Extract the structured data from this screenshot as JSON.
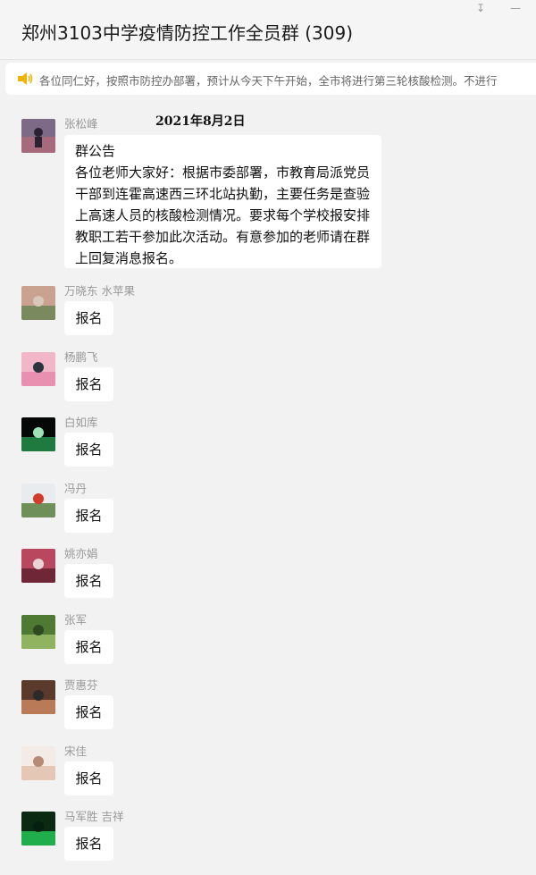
{
  "window": {
    "title": "郑州3103中学疫情防控工作全员群 (309)",
    "pin_glyph": "↧",
    "minimize_glyph": "—"
  },
  "notice": {
    "text": "各位同仁好，按照市防控办部署，预计从今天下午开始，全市将进行第三轮核酸检测。不进行"
  },
  "chat": {
    "date_stamp": "2021年8月2日",
    "announcement": {
      "sender": "张松峰",
      "title": "群公告",
      "body": "各位老师大家好：根据市委部署，市教育局派党员干部到连霍高速西三环北站执勤，主要任务是查验上高速人员的核酸检测情况。要求每个学校报安排教职工若干参加此次活动。有意参加的老师请在群上回复消息报名。"
    },
    "replies": [
      {
        "sender": "万晓东 水苹果",
        "text": "报名",
        "avatar_colors": [
          "#c9a38f",
          "#7a8a5e",
          "#d8c7bb"
        ]
      },
      {
        "sender": "杨鹏飞",
        "text": "报名",
        "avatar_colors": [
          "#f1b7c9",
          "#e98fb0",
          "#2c3442"
        ]
      },
      {
        "sender": "白如库",
        "text": "报名",
        "avatar_colors": [
          "#050806",
          "#1f7a3f",
          "#9ee2b8"
        ]
      },
      {
        "sender": "冯丹",
        "text": "报名",
        "avatar_colors": [
          "#e9ecef",
          "#6f8f5a",
          "#d33b2a"
        ]
      },
      {
        "sender": "姚亦娟",
        "text": "报名",
        "avatar_colors": [
          "#b9485e",
          "#6f2636",
          "#e8d4d6"
        ]
      },
      {
        "sender": "张军",
        "text": "报名",
        "avatar_colors": [
          "#4f7a34",
          "#8fb35f",
          "#2f4a23"
        ]
      },
      {
        "sender": "贾惠芬",
        "text": "报名",
        "avatar_colors": [
          "#5a3a2a",
          "#b97a57",
          "#2f2a2a"
        ]
      },
      {
        "sender": "宋佳",
        "text": "报名",
        "avatar_colors": [
          "#f3ece6",
          "#e4c7b4",
          "#b78a74"
        ]
      },
      {
        "sender": "马军胜 吉祥",
        "text": "报名",
        "avatar_colors": [
          "#0b2a12",
          "#1fae4b",
          "#052010"
        ]
      }
    ]
  }
}
